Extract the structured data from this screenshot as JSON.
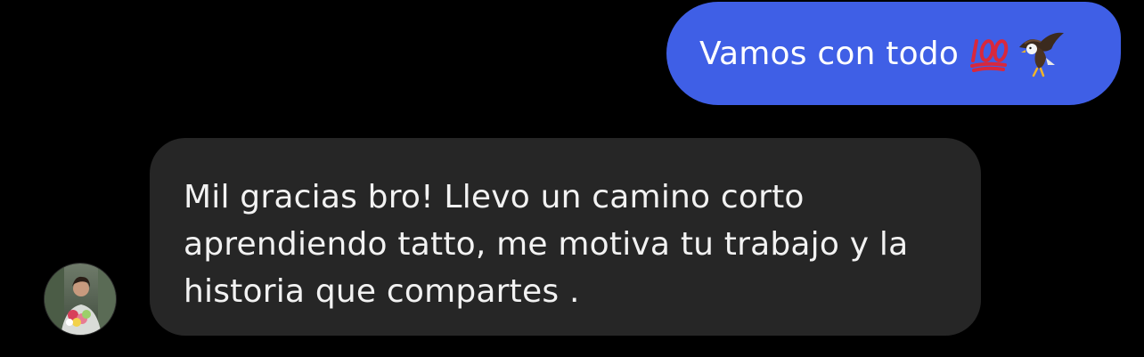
{
  "conversation": {
    "outgoing_message": {
      "text": "Vamos con todo",
      "emojis": [
        "hundred-points-emoji",
        "eagle-emoji"
      ],
      "bubble_color": "#3f5fe6",
      "text_color": "#ffffff"
    },
    "incoming_message": {
      "lines": [
        "Mil gracias bro! Llevo un camino corto",
        "aprendiendo tatto, me motiva tu trabajo y la",
        "historia que compartes ."
      ],
      "bubble_color": "#262626",
      "text_color": "#f2f2f2"
    },
    "sender_avatar": {
      "icon": "profile-photo-avatar"
    }
  },
  "background_color": "#000000"
}
